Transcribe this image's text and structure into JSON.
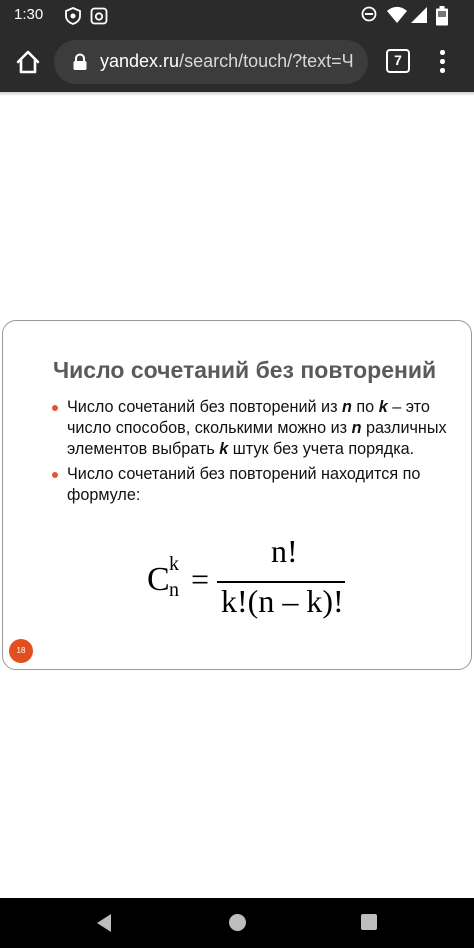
{
  "status_bar": {
    "time": "1:30",
    "left_icons": [
      "shield-icon",
      "camera-icon"
    ],
    "right_icons": [
      "do-not-disturb-icon",
      "wifi-icon",
      "signal-icon",
      "battery-icon"
    ]
  },
  "browser": {
    "url_host": "yandex.ru",
    "url_path": "/search/touch/?text=Ч",
    "tab_count": "7"
  },
  "slide": {
    "title": "Число сочетаний без повторений",
    "bullet1": {
      "part1": "Число сочетаний без повторений из ",
      "var_n": "n",
      "part2": " по ",
      "var_k": "k",
      "part3": " – это число способов, сколькими можно из ",
      "var_n2": "n",
      "part4": " различных элементов выбрать ",
      "var_k2": "k",
      "part5": " штук без учета порядка."
    },
    "bullet2": "Число сочетаний без повторений находится по формуле:",
    "formula": {
      "c": "C",
      "sup": "k",
      "sub": "n",
      "eq": "=",
      "numerator": "n!",
      "denominator": "k!(n – k)!"
    },
    "slide_number": "18"
  },
  "colors": {
    "bar_bg": "#2b2b2b",
    "bullet_accent": "#e2562c",
    "slide_number_bg": "#e24f1e",
    "title_color": "#5a5a5a"
  }
}
